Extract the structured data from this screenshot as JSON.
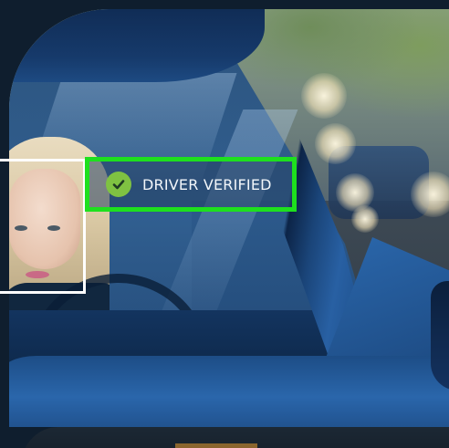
{
  "badge": {
    "label": "DRIVER VERIFIED",
    "icon": "check-circle-icon",
    "border_color": "#1ee01e",
    "icon_color": "#7fc242"
  }
}
